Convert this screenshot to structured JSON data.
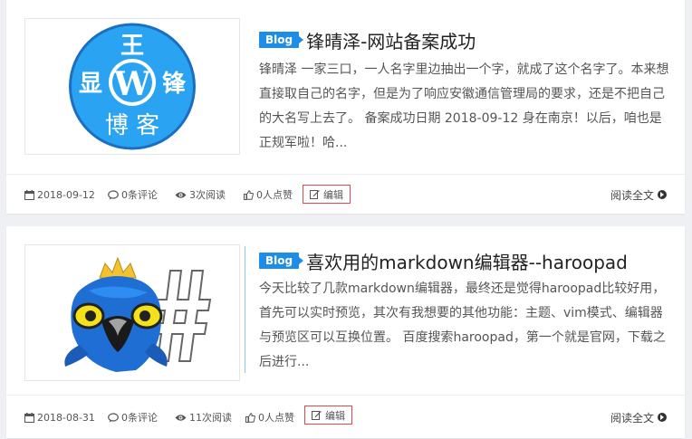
{
  "posts": [
    {
      "category": "Blog",
      "title": "锋晴泽-网站备案成功",
      "excerpt": "锋晴泽 一家三口，一人名字里边抽出一个字，就成了这个名字了。本来想直接取自己的名字，但是为了响应安徽通信管理局的要求，还是不把自己的大名写上去了。 备案成功日期 2018-09-12 身在南京！以后，咱也是正规军啦！哈...",
      "logo_chars": {
        "top": "王",
        "left": "显",
        "right": "锋",
        "bottom": "博 客"
      },
      "date": "2018-09-12",
      "comments": "0条评论",
      "views": "3次阅读",
      "likes": "0人点赞",
      "edit": "编辑",
      "read_more": "阅读全文"
    },
    {
      "category": "Blog",
      "title": "喜欢用的markdown编辑器--haroopad",
      "excerpt": "今天比较了几款markdown编辑器，最终还是觉得haroopad比较好用，首先可以实时预览，其次有我想要的其他功能：主题、vim模式、编辑器与预览区可以互换位置。 百度搜索haroopad，第一个就是官网，下载之后进行...",
      "date": "2018-08-31",
      "comments": "0条评论",
      "views": "11次阅读",
      "likes": "0人点赞",
      "edit": "编辑",
      "read_more": "阅读全文"
    }
  ],
  "icons": [
    "calendar-icon",
    "comment-icon",
    "eye-icon",
    "thumbs-up-icon",
    "edit-icon",
    "chevron-circle-right-icon",
    "wordpress-logo",
    "haroopad-logo"
  ],
  "colors": {
    "accent": "#1e8de8",
    "edit_border": "#e1474c",
    "logo_blue": "#2aa3f2"
  }
}
